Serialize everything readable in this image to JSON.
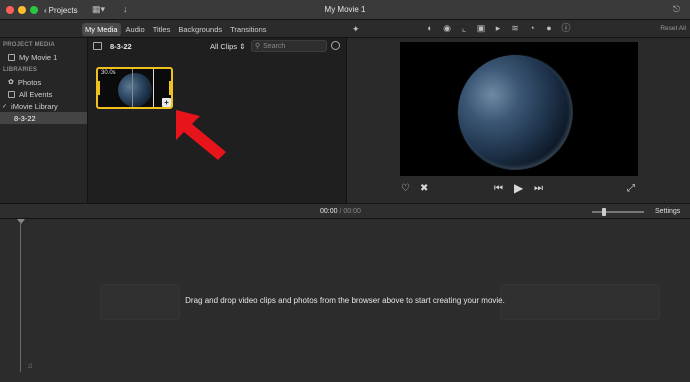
{
  "window": {
    "title": "My Movie 1",
    "projects_label": "Projects"
  },
  "tabs": [
    "My Media",
    "Audio",
    "Titles",
    "Backgrounds",
    "Transitions"
  ],
  "reset_all": "Reset All",
  "sidebar": {
    "project_media_header": "PROJECT MEDIA",
    "project_item": "My Movie 1",
    "libraries_header": "LIBRARIES",
    "library_items": [
      "Photos",
      "All Events"
    ],
    "library_name": "iMovie Library",
    "event_name": "8-3-22"
  },
  "browser": {
    "event_title": "8-3-22",
    "filter": "All Clips",
    "search_placeholder": "Search",
    "clip_duration": "30.0s"
  },
  "timeline": {
    "current_time": "00:00",
    "separator": "/",
    "total_time": "00:00",
    "settings_label": "Settings",
    "drop_message": "Drag and drop video clips and photos from the browser above to start creating your movie."
  },
  "colors": {
    "accent_yellow": "#f0c11c",
    "annotation_red": "#e8141c",
    "background": "#1e1e1e"
  },
  "icons": {
    "titlebar": [
      "chevron-left-icon",
      "grid-menu-icon",
      "download-arrow-icon",
      "share-icon"
    ],
    "adjust_toolbar": [
      "magic-wand-icon",
      "color-balance-icon",
      "color-correction-icon",
      "crop-icon",
      "stabilization-icon",
      "volume-icon",
      "noise-reduction-icon",
      "speed-icon",
      "filter-icon",
      "info-icon"
    ],
    "viewer_controls": [
      "heart-icon",
      "reject-icon",
      "skip-back-icon",
      "play-icon",
      "skip-forward-icon",
      "fullscreen-icon"
    ]
  }
}
